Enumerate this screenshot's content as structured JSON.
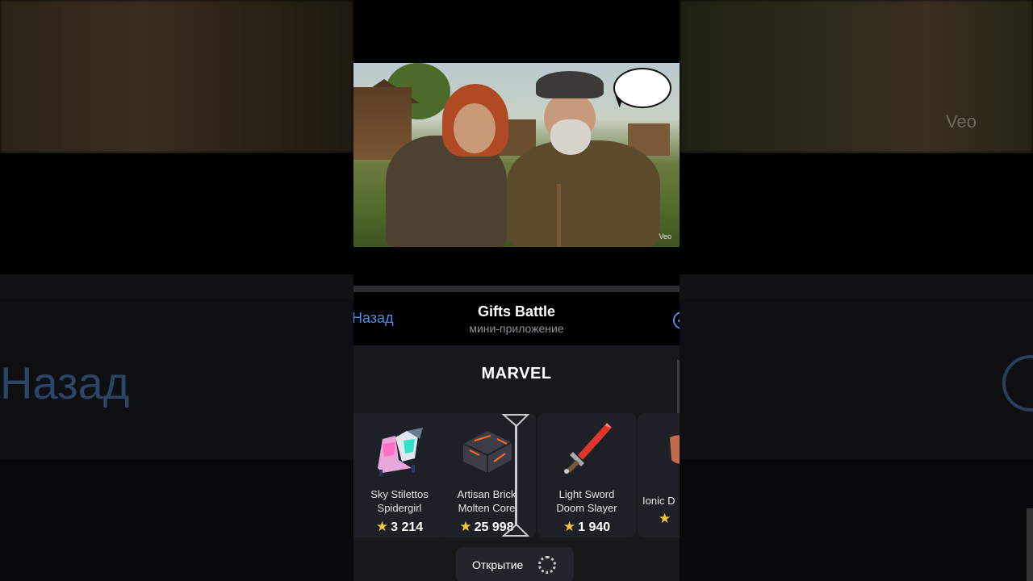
{
  "background": {
    "left_text": "Назад",
    "right_watermark": "Veo"
  },
  "video": {
    "watermark": "Veo"
  },
  "header": {
    "back_label": "Назад",
    "title": "Gifts Battle",
    "subtitle": "мини-приложение",
    "more_icon": "more-circle-icon"
  },
  "collection": {
    "title": "MARVEL",
    "items": [
      {
        "name_line1": "Sky Stilettos",
        "name_line2": "Spidergirl",
        "price": "3 214",
        "icon": "stiletto-icon"
      },
      {
        "name_line1": "Artisan Brick",
        "name_line2": "Molten Core",
        "price": "25 998",
        "icon": "brick-icon"
      },
      {
        "name_line1": "Light Sword",
        "name_line2": "Doom Slayer",
        "price": "1 940",
        "icon": "sword-icon"
      },
      {
        "name_line1": "Ionic D",
        "name_line2": "",
        "price": "",
        "icon": "ionic-icon"
      }
    ]
  },
  "open_button": {
    "label": "Открытие",
    "spinner_icon": "loading-spinner-icon"
  },
  "colors": {
    "accent": "#4f8ae6",
    "star": "#f6c443",
    "panel": "#16181c",
    "card": "#1d2026"
  }
}
